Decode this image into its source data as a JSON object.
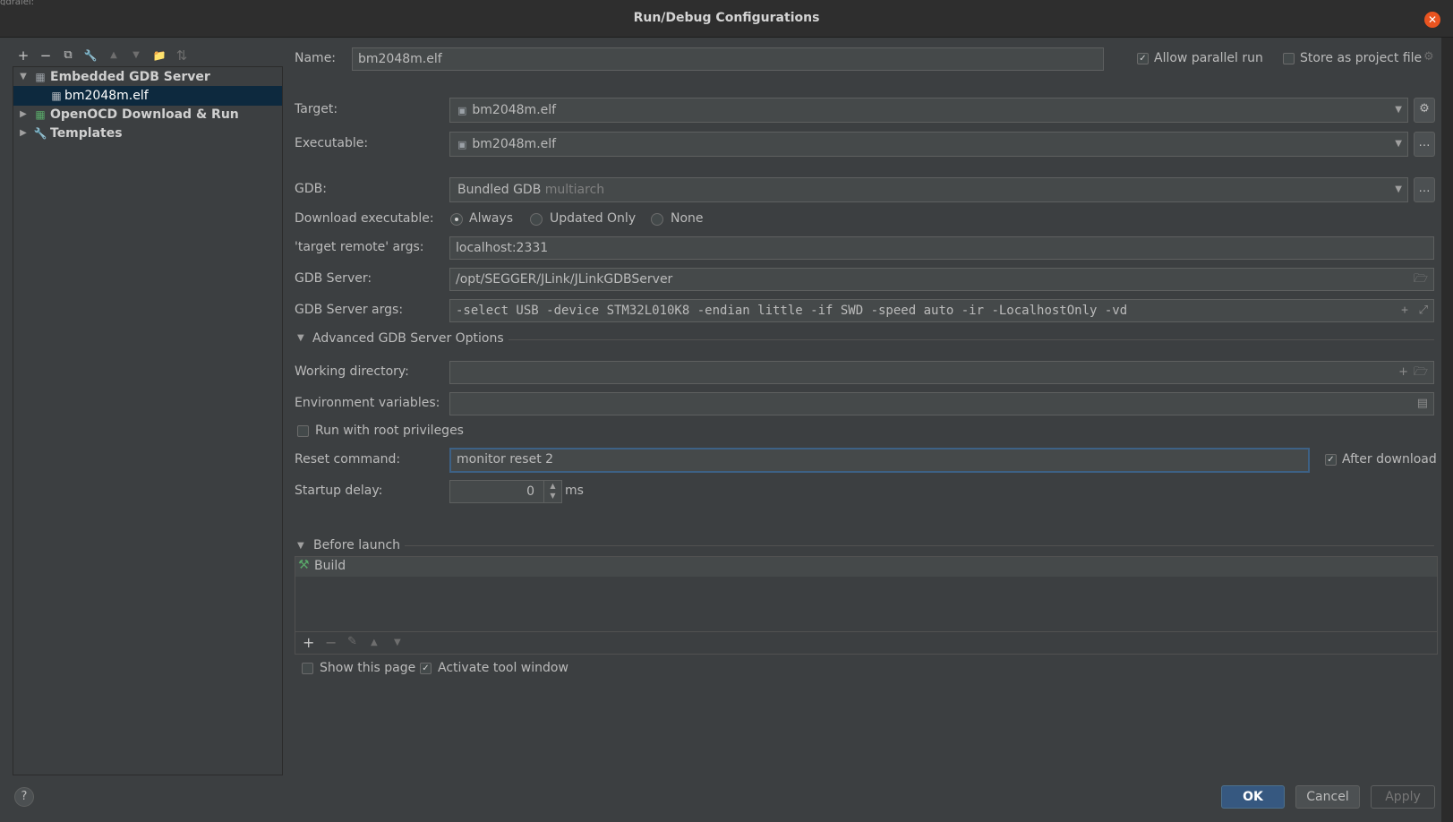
{
  "dialog": {
    "title": "Run/Debug Configurations",
    "close_icon": "close-icon",
    "top_strip_text": "gdraiel:"
  },
  "toolbar": {
    "add": "+",
    "remove": "−",
    "copy": "⧉",
    "edit": "🔧",
    "up": "▲",
    "down": "▼",
    "folder": "📁",
    "sort": "⇅"
  },
  "tree": {
    "items": [
      {
        "label": "Embedded GDB Server",
        "expanded": true,
        "level": 0
      },
      {
        "label": "bm2048m.elf",
        "selected": true,
        "level": 1
      },
      {
        "label": "OpenOCD Download & Run",
        "expanded": false,
        "level": 0
      },
      {
        "label": "Templates",
        "expanded": false,
        "level": 0
      }
    ]
  },
  "form": {
    "name_label": "Name:",
    "name_value": "bm2048m.elf",
    "allow_parallel_label": "Allow parallel run",
    "allow_parallel_checked": true,
    "store_project_label": "Store as project file",
    "store_project_checked": false,
    "target_label": "Target:",
    "target_value": "bm2048m.elf",
    "executable_label": "Executable:",
    "executable_value": "bm2048m.elf",
    "gdb_label": "GDB:",
    "gdb_value": "Bundled GDB",
    "gdb_hint": "multiarch",
    "download_label": "Download executable:",
    "download_options": [
      "Always",
      "Updated Only",
      "None"
    ],
    "download_selected": "Always",
    "target_remote_label": "'target remote' args:",
    "target_remote_value": "localhost:2331",
    "gdb_server_label": "GDB Server:",
    "gdb_server_value": "/opt/SEGGER/JLink/JLinkGDBServer",
    "gdb_server_args_label": "GDB Server args:",
    "gdb_server_args_value": "-select USB -device STM32L010K8 -endian little -if SWD -speed auto -ir -LocalhostOnly -vd",
    "advanced_label": "Advanced GDB Server Options",
    "working_dir_label": "Working directory:",
    "working_dir_value": "",
    "env_vars_label": "Environment variables:",
    "env_vars_value": "",
    "root_priv_label": "Run with root privileges",
    "root_priv_checked": false,
    "reset_cmd_label": "Reset command:",
    "reset_cmd_value": "monitor reset 2",
    "after_download_label": "After download",
    "after_download_checked": true,
    "startup_delay_label": "Startup delay:",
    "startup_delay_value": "0",
    "startup_delay_unit": "ms"
  },
  "before_launch": {
    "label": "Before launch",
    "items": [
      {
        "label": "Build",
        "icon": "hammer-icon"
      }
    ],
    "toolbar": {
      "add": "+",
      "remove": "−",
      "edit": "✎",
      "up": "▲",
      "down": "▼"
    },
    "show_page_label": "Show this page",
    "show_page_checked": false,
    "activate_tool_label": "Activate tool window",
    "activate_tool_checked": true
  },
  "buttons": {
    "ok": "OK",
    "cancel": "Cancel",
    "apply": "Apply",
    "help": "?"
  },
  "colors": {
    "accent": "#365880",
    "selection": "#0d293e",
    "close": "#e95420",
    "build_icon": "#59a869"
  }
}
